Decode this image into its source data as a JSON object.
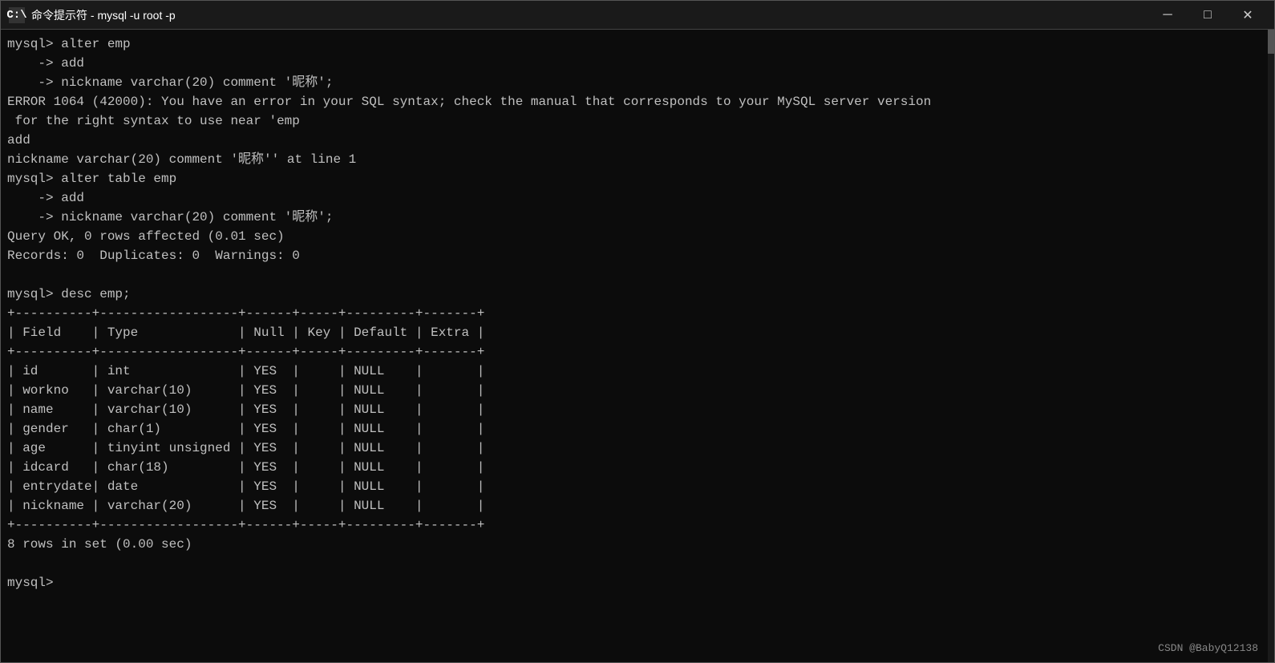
{
  "titleBar": {
    "icon": "C:\\",
    "title": "命令提示符 - mysql  -u root -p",
    "minimizeLabel": "─",
    "maximizeLabel": "□",
    "closeLabel": "✕"
  },
  "terminal": {
    "lines": [
      {
        "type": "normal",
        "text": "mysql> alter emp"
      },
      {
        "type": "normal",
        "text": "    -> add"
      },
      {
        "type": "normal",
        "text": "    -> nickname varchar(20) comment '昵称';"
      },
      {
        "type": "normal",
        "text": "ERROR 1064 (42000): You have an error in your SQL syntax; check the manual that corresponds to your MySQL server version"
      },
      {
        "type": "normal",
        "text": " for the right syntax to use near 'emp"
      },
      {
        "type": "normal",
        "text": "add"
      },
      {
        "type": "normal",
        "text": "nickname varchar(20) comment '昵称'' at line 1"
      },
      {
        "type": "normal",
        "text": "mysql> alter table emp"
      },
      {
        "type": "normal",
        "text": "    -> add"
      },
      {
        "type": "normal",
        "text": "    -> nickname varchar(20) comment '昵称';"
      },
      {
        "type": "normal",
        "text": "Query OK, 0 rows affected (0.01 sec)"
      },
      {
        "type": "normal",
        "text": "Records: 0  Duplicates: 0  Warnings: 0"
      },
      {
        "type": "blank",
        "text": ""
      },
      {
        "type": "normal",
        "text": "mysql> desc emp;"
      },
      {
        "type": "table",
        "text": "+----------+------------------+------+-----+---------+-------+"
      },
      {
        "type": "table",
        "text": "| Field    | Type             | Null | Key | Default | Extra |"
      },
      {
        "type": "table",
        "text": "+----------+------------------+------+-----+---------+-------+"
      },
      {
        "type": "table",
        "text": "| id       | int              | YES  |     | NULL    |       |"
      },
      {
        "type": "table",
        "text": "| workno   | varchar(10)      | YES  |     | NULL    |       |"
      },
      {
        "type": "table",
        "text": "| name     | varchar(10)      | YES  |     | NULL    |       |"
      },
      {
        "type": "table",
        "text": "| gender   | char(1)          | YES  |     | NULL    |       |"
      },
      {
        "type": "table",
        "text": "| age      | tinyint unsigned | YES  |     | NULL    |       |"
      },
      {
        "type": "table",
        "text": "| idcard   | char(18)         | YES  |     | NULL    |       |"
      },
      {
        "type": "table",
        "text": "| entrydate| date             | YES  |     | NULL    |       |"
      },
      {
        "type": "table",
        "text": "| nickname | varchar(20)      | YES  |     | NULL    |       |"
      },
      {
        "type": "table",
        "text": "+----------+------------------+------+-----+---------+-------+"
      },
      {
        "type": "normal",
        "text": "8 rows in set (0.00 sec)"
      },
      {
        "type": "blank",
        "text": ""
      },
      {
        "type": "normal",
        "text": "mysql> "
      }
    ],
    "watermark": "CSDN @BabyQ12138"
  }
}
